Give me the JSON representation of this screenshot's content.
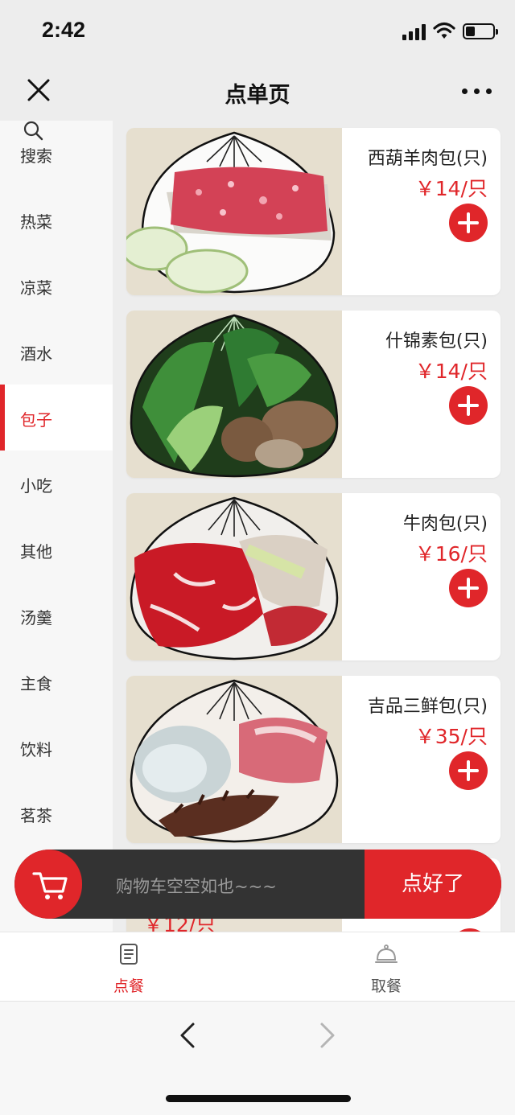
{
  "status_bar": {
    "time": "2:42"
  },
  "nav": {
    "title": "点单页",
    "close_icon": "close-icon",
    "more_icon": "more-icon"
  },
  "sidebar": {
    "items": [
      {
        "label": "搜索",
        "icon": "search-icon"
      },
      {
        "label": "热菜"
      },
      {
        "label": "凉菜"
      },
      {
        "label": "酒水"
      },
      {
        "label": "包子",
        "active": true
      },
      {
        "label": "小吃"
      },
      {
        "label": "其他"
      },
      {
        "label": "汤羹"
      },
      {
        "label": "主食"
      },
      {
        "label": "饮料"
      },
      {
        "label": "茗茶"
      }
    ]
  },
  "products": [
    {
      "name": "西葫羊肉包(只)",
      "price": "￥14/只",
      "add_icon": "plus-icon"
    },
    {
      "name": "什锦素包(只)",
      "price": "￥14/只",
      "add_icon": "plus-icon"
    },
    {
      "name": "牛肉包(只)",
      "price": "￥16/只",
      "add_icon": "plus-icon"
    },
    {
      "name": "吉品三鲜包(只)",
      "price": "￥35/只",
      "add_icon": "plus-icon"
    }
  ],
  "peek_product": {
    "price": "￥12/只"
  },
  "cart": {
    "empty_text": "购物车空空如也~~~",
    "checkout_label": "点好了",
    "icon": "cart-icon"
  },
  "tabs": [
    {
      "label": "点餐",
      "icon": "menu-list-icon",
      "active": true
    },
    {
      "label": "取餐",
      "icon": "cloche-icon"
    }
  ],
  "browser": {
    "back_icon": "chevron-left-icon",
    "forward_icon": "chevron-right-icon"
  },
  "colors": {
    "accent": "#e0262a",
    "cart_bar": "#333333",
    "background": "#ededed"
  }
}
